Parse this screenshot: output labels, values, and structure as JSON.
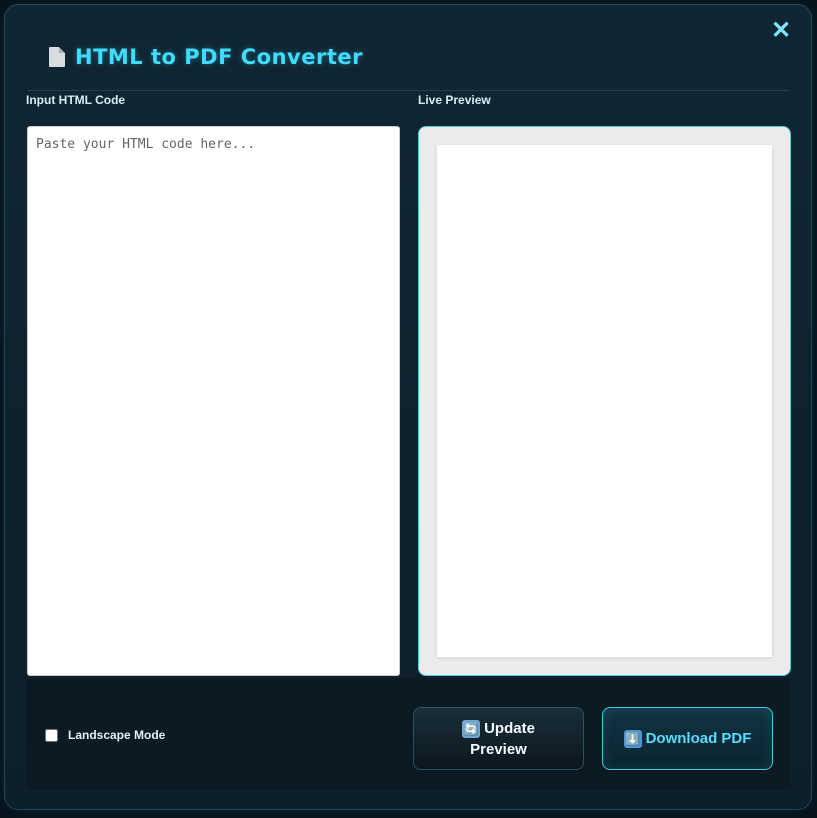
{
  "window": {
    "title": "HTML to PDF Converter",
    "close_symbol": "✕",
    "icon": "document-icon"
  },
  "input_panel": {
    "label": "Input HTML Code",
    "placeholder": "Paste your HTML code here...",
    "value": ""
  },
  "preview_panel": {
    "label": "Live Preview"
  },
  "options": {
    "landscape_label": "Landscape Mode",
    "landscape_checked": false
  },
  "actions": {
    "update_icon": "🔄",
    "update_label_line1": "Update",
    "update_label_line2": "Preview",
    "download_icon": "⬇️",
    "download_label": "Download PDF"
  },
  "colors": {
    "accent": "#3fdcff",
    "background": "#102633",
    "panel_border": "#56c8e0"
  }
}
